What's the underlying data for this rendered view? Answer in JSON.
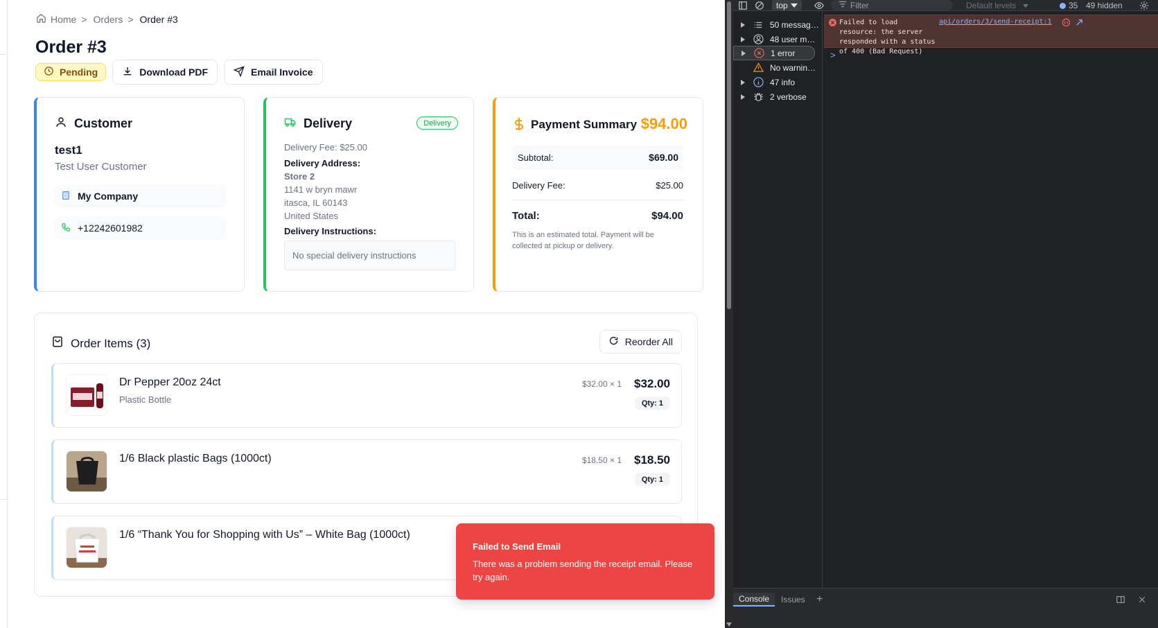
{
  "breadcrumb": {
    "home": "Home",
    "orders": "Orders",
    "current": "Order #3",
    "sep": ">"
  },
  "page": {
    "title": "Order #3"
  },
  "actions": {
    "status": "Pending",
    "download": "Download PDF",
    "email": "Email Invoice"
  },
  "customer": {
    "heading": "Customer",
    "name": "test1",
    "subtitle": "Test User Customer",
    "company": "My Company",
    "phone": "+12242601982"
  },
  "delivery": {
    "heading": "Delivery",
    "tag": "Delivery",
    "fee_line": "Delivery Fee: $25.00",
    "address_label": "Delivery Address:",
    "store": "Store 2",
    "street": "1141 w bryn mawr",
    "city": "itasca, IL 60143",
    "country": "United States",
    "instructions_label": "Delivery Instructions:",
    "instructions": "No special delivery instructions"
  },
  "payment": {
    "heading": "Payment Summary",
    "total_head": "$94.00",
    "subtotal_label": "Subtotal:",
    "subtotal": "$69.00",
    "fee_label": "Delivery Fee:",
    "fee": "$25.00",
    "total_label": "Total:",
    "total": "$94.00",
    "note": "This is an estimated total. Payment will be collected at pickup or delivery."
  },
  "items": {
    "heading": "Order Items (3)",
    "reorder": "Reorder All",
    "list": [
      {
        "name": "Dr Pepper 20oz 24ct",
        "sub": "Plastic Bottle",
        "unit": "$32.00 × 1",
        "price": "$32.00",
        "qty": "Qty: 1"
      },
      {
        "name": "1/6 Black plastic Bags (1000ct)",
        "sub": "",
        "unit": "$18.50 × 1",
        "price": "$18.50",
        "qty": "Qty: 1"
      },
      {
        "name": "1/6 “Thank You for Shopping with Us” – White Bag (1000ct)",
        "sub": "",
        "unit": "",
        "price": "",
        "qty": ""
      }
    ]
  },
  "toast": {
    "title": "Failed to Send Email",
    "message": "There was a problem sending the receipt email. Please try again."
  },
  "devtools": {
    "context": "top",
    "filter_placeholder": "Filter",
    "levels": "Default levels",
    "issues_count": "35",
    "hidden": "49 hidden",
    "sidebar": [
      {
        "label": "50 messag…",
        "icon": "list-icon"
      },
      {
        "label": "48 user m…",
        "icon": "user-icon"
      },
      {
        "label": "1 error",
        "icon": "error-icon"
      },
      {
        "label": "No warnin…",
        "icon": "warning-icon"
      },
      {
        "label": "47 info",
        "icon": "info-icon"
      },
      {
        "label": "2 verbose",
        "icon": "bug-icon"
      }
    ],
    "error_text": "Failed to load\nresource: the server\nresponded with a status of 400 (Bad Request)",
    "error_link": "api/orders/3/send-receipt:1",
    "prompt": ">",
    "tabs": {
      "console": "Console",
      "issues": "Issues"
    }
  },
  "colors": {
    "accent_blue": "#3b82f6",
    "accent_green": "#22c55e",
    "accent_orange": "#f59e0b",
    "toast_red": "#ef4444",
    "pending_bg": "#fef9c3"
  }
}
